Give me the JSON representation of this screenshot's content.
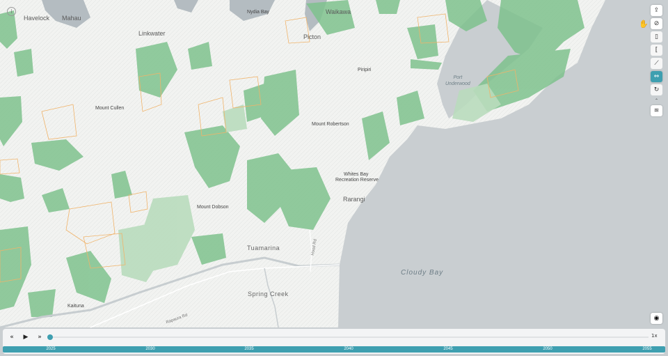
{
  "map": {
    "places": [
      {
        "name": "Havelock",
        "cls": "town"
      },
      {
        "name": "Mahau",
        "cls": "town"
      },
      {
        "name": "Nydia Bay",
        "cls": "small"
      },
      {
        "name": "Waikawa",
        "cls": "town"
      },
      {
        "name": "Linkwater",
        "cls": "town"
      },
      {
        "name": "Picton",
        "cls": "town"
      },
      {
        "name": "Piripiri",
        "cls": "small"
      },
      {
        "name": "Mount Cullen",
        "cls": "small"
      },
      {
        "name": "Mount Robertson",
        "cls": "small"
      },
      {
        "name": "Whites Bay",
        "cls": "small"
      },
      {
        "name": "Recreation Reserve",
        "cls": "small"
      },
      {
        "name": "Rarangi",
        "cls": "town"
      },
      {
        "name": "Mount Dobson",
        "cls": "small"
      },
      {
        "name": "Tuamarina",
        "cls": "big"
      },
      {
        "name": "Spring Creek",
        "cls": "big"
      },
      {
        "name": "Kaituna",
        "cls": "small"
      }
    ],
    "water_labels": {
      "port_underwood": "Port\nUnderwood",
      "cloudy_bay": "Cloudy Bay"
    },
    "roads": {
      "rapaura": "Rapaura Rd",
      "hood": "Hood Rd"
    },
    "colors": {
      "land": "#f2f3f1",
      "sea": "#c9ced1",
      "forest": "#7fc28e",
      "forest_light": "#b9dcbd",
      "harvest": "#f0b36a",
      "lake": "#b4bcc1"
    }
  },
  "toolbar": {
    "buttons": [
      "share-icon",
      "compass-icon",
      "bookmark-icon",
      "bracket-icon",
      "chart-icon",
      "timeline-icon",
      "rotate-icon",
      "layers-icon"
    ],
    "active": "timeline-icon"
  },
  "player": {
    "rewind": "«",
    "play": "▶",
    "forward": "»",
    "speed": "1x",
    "progress": 0,
    "years": [
      "2025",
      "2030",
      "2035",
      "2040",
      "2045",
      "2050",
      "2055"
    ]
  }
}
